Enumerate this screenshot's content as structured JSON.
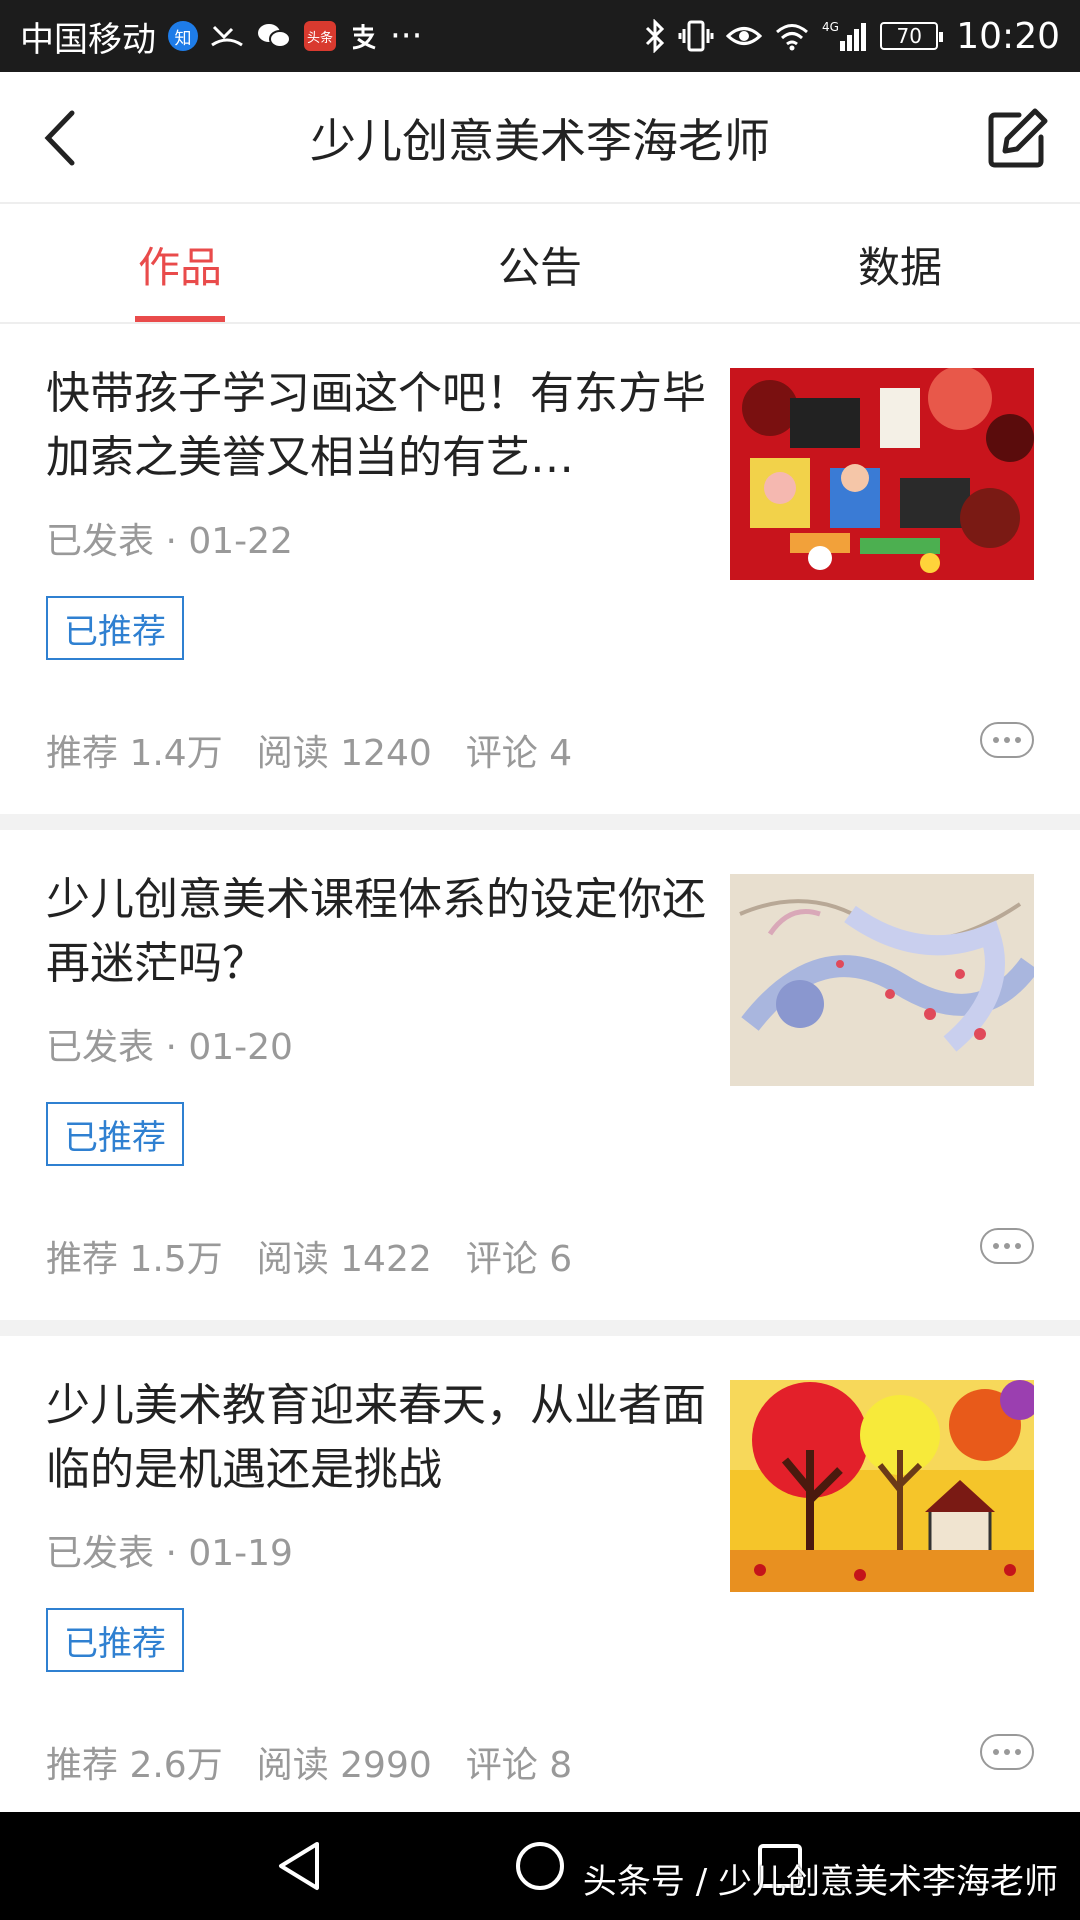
{
  "status_bar": {
    "carrier": "中国移动",
    "badge_zhi": "知",
    "badge_toutiao": "头条",
    "more": "···",
    "network": "4G",
    "battery": "70",
    "time": "10:20"
  },
  "header": {
    "title": "少儿创意美术李海老师"
  },
  "tabs": [
    {
      "label": "作品",
      "active": true
    },
    {
      "label": "公告",
      "active": false
    },
    {
      "label": "数据",
      "active": false
    }
  ],
  "articles": [
    {
      "title": "快带孩子学习画这个吧！有东方毕加索之美誉又相当的有艺…",
      "meta": "已发表 · 01-22",
      "tag": "已推荐",
      "stats": {
        "recommend": "推荐 1.4万",
        "read": "阅读 1240",
        "comment": "评论 4"
      },
      "thumb": "folk-painting-red"
    },
    {
      "title": "少儿创意美术课程体系的设定你还再迷茫吗？",
      "meta": "已发表 · 01-20",
      "tag": "已推荐",
      "stats": {
        "recommend": "推荐 1.5万",
        "read": "阅读 1422",
        "comment": "评论 6"
      },
      "thumb": "phoenix-drawing"
    },
    {
      "title": "少儿美术教育迎来春天，从业者面临的是机遇还是挑战",
      "meta": "已发表 · 01-19",
      "tag": "已推荐",
      "stats": {
        "recommend": "推荐 2.6万",
        "read": "阅读 2990",
        "comment": "评论 8"
      },
      "thumb": "autumn-trees-painting"
    }
  ],
  "watermark": "头条号 / 少儿创意美术李海老师",
  "colors": {
    "accent": "#e94b4b",
    "tag_blue": "#2f80d1",
    "muted": "#999999"
  }
}
